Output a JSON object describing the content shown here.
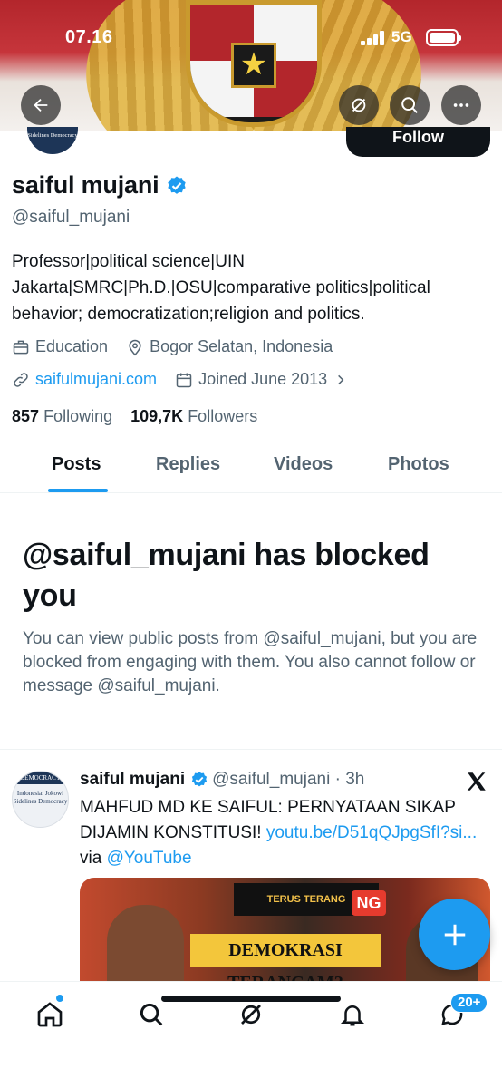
{
  "status": {
    "time": "07.16",
    "network": "5G"
  },
  "profile": {
    "avatar_text": "Sidelines Democracy",
    "follow_label": "Follow",
    "name": "saiful mujani",
    "handle": "@saiful_mujani",
    "bio": "Professor|political science|UIN Jakarta|SMRC|Ph.D.|OSU|comparative politics|political behavior; democratization;religion and politics.",
    "category": "Education",
    "location": "Bogor Selatan, Indonesia",
    "website": "saifulmujani.com",
    "joined": "Joined June 2013",
    "following_count": "857",
    "following_label": "Following",
    "followers_count": "109,7K",
    "followers_label": "Followers"
  },
  "tabs": [
    "Posts",
    "Replies",
    "Videos",
    "Photos"
  ],
  "blocked": {
    "title": "@saiful_mujani has blocked you",
    "description": "You can view public posts from @saiful_mujani, but you are blocked from engaging with them. You also cannot follow or message @saiful_mujani."
  },
  "tweet": {
    "avatar_header": "DEMOCRACY",
    "avatar_body": "Indonesia: Jokowi Sidelines Democracy",
    "name": "saiful mujani",
    "handle_time": "@saiful_mujani · 3h",
    "text": "MAHFUD MD KE SAIFUL: PERNYATAAN SIKAP DIJAMIN KONSTITUSI! ",
    "link": "youtu.be/D51qQJpgSfI?si...",
    "via": " via ",
    "mention": "@YouTube",
    "media_logo": "TERUS TERANG",
    "media_banner": "DEMOKRASI TERANCAM?",
    "media_tag": "NG"
  },
  "nav": {
    "dm_badge": "20+"
  },
  "colors": {
    "accent": "#1d9bf0",
    "text": "#0f1419",
    "muted": "#536471"
  }
}
